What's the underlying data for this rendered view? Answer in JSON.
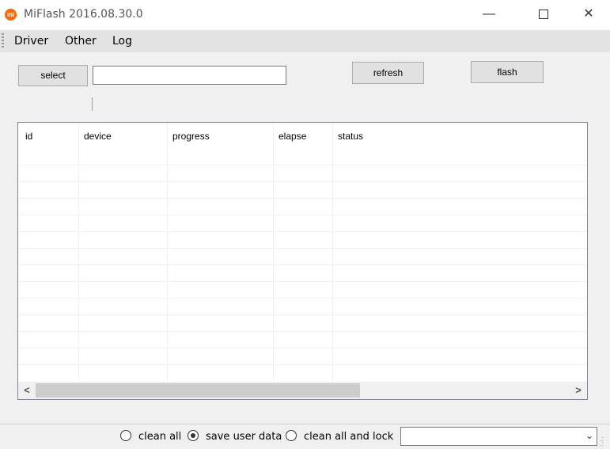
{
  "window": {
    "title": "MiFlash 2016.08.30.0",
    "icon_text": "mi",
    "controls": {
      "minimize": "—",
      "maximize": "",
      "close": "✕"
    }
  },
  "menu": {
    "items": [
      "Driver",
      "Other",
      "Log"
    ]
  },
  "toolbar": {
    "select_label": "select",
    "path_value": "",
    "refresh_label": "refresh",
    "flash_label": "flash"
  },
  "table": {
    "columns": [
      "id",
      "device",
      "progress",
      "elapse",
      "status"
    ],
    "rows": []
  },
  "options": {
    "clean_all": "clean all",
    "save_user_data": "save user data",
    "clean_all_and_lock": "clean all and lock",
    "selected": "save user data"
  },
  "dropdown": {
    "value": ""
  },
  "scrollbar": {
    "left_arrow": "<",
    "right_arrow": ">"
  },
  "colors": {
    "accent": "#ff6700",
    "menubar": "#e3e3e3",
    "background": "#f0f0f0"
  }
}
